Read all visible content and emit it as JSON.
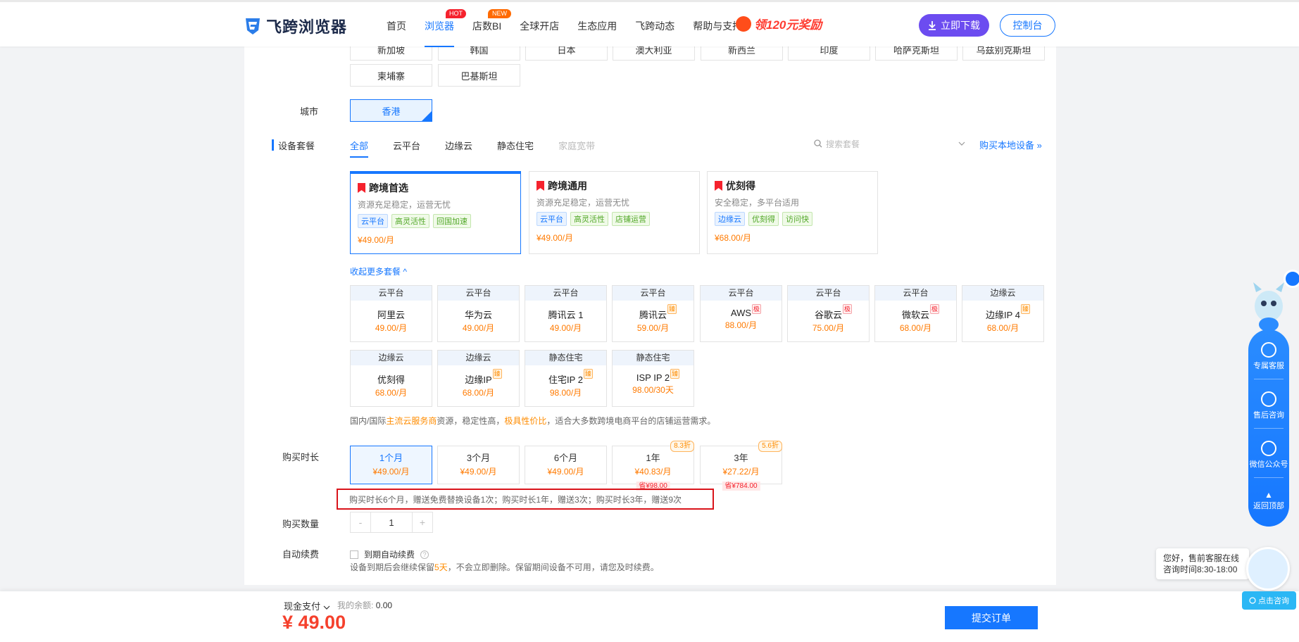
{
  "header": {
    "logo_text": "飞跨浏览器",
    "nav": [
      {
        "label": "首页"
      },
      {
        "label": "浏览器",
        "badge": "HOT"
      },
      {
        "label": "店数BI",
        "badge": "NEW"
      },
      {
        "label": "全球开店"
      },
      {
        "label": "生态应用"
      },
      {
        "label": "飞跨动态"
      },
      {
        "label": "帮助与支持"
      }
    ],
    "promo": "领120元奖励",
    "download_label": "立即下载",
    "console_label": "控制台"
  },
  "region": {
    "countries_row1": [
      "新加坡",
      "韩国",
      "日本",
      "澳大利亚",
      "新西兰",
      "印度",
      "哈萨克斯坦",
      "乌兹别克斯坦"
    ],
    "countries_row2": [
      "柬埔寨",
      "巴基斯坦"
    ],
    "city_label": "城市",
    "city_selected": "香港"
  },
  "package": {
    "label": "设备套餐",
    "tabs": [
      "全部",
      "云平台",
      "边缘云",
      "静态住宅",
      "家庭宽带"
    ],
    "search_placeholder": "搜索套餐",
    "buy_local": "购买本地设备 »",
    "featured": [
      {
        "title": "跨境首选",
        "desc": "资源充足稳定，运营无忧",
        "tags": [
          "云平台",
          "高灵活性",
          "回国加速"
        ],
        "price": "¥49.00/月"
      },
      {
        "title": "跨境通用",
        "desc": "资源充足稳定，运营无忧",
        "tags": [
          "云平台",
          "高灵活性",
          "店铺运营"
        ],
        "price": "¥49.00/月"
      },
      {
        "title": "优刻得",
        "desc": "安全稳定，多平台适用",
        "tags": [
          "边缘云",
          "优刻得",
          "访问快"
        ],
        "price": "¥68.00/月"
      }
    ],
    "collapse_label": "收起更多套餐 ^",
    "cards": [
      {
        "type": "云平台",
        "name": "阿里云",
        "price": "49.00/月",
        "badge": ""
      },
      {
        "type": "云平台",
        "name": "华为云",
        "price": "49.00/月",
        "badge": ""
      },
      {
        "type": "云平台",
        "name": "腾讯云 1",
        "price": "49.00/月",
        "badge": ""
      },
      {
        "type": "云平台",
        "name": "腾讯云",
        "price": "59.00/月",
        "badge": "臻"
      },
      {
        "type": "云平台",
        "name": "AWS",
        "price": "88.00/月",
        "badge": "极"
      },
      {
        "type": "云平台",
        "name": "谷歌云",
        "price": "75.00/月",
        "badge": "极"
      },
      {
        "type": "云平台",
        "name": "微软云",
        "price": "68.00/月",
        "badge": "极"
      },
      {
        "type": "边缘云",
        "name": "边缘IP 4",
        "price": "68.00/月",
        "badge": "臻"
      },
      {
        "type": "边缘云",
        "name": "优刻得",
        "price": "68.00/月",
        "badge": ""
      },
      {
        "type": "边缘云",
        "name": "边缘IP",
        "price": "68.00/月",
        "badge": "臻"
      },
      {
        "type": "静态住宅",
        "name": "住宅IP 2",
        "price": "98.00/月",
        "badge": "臻"
      },
      {
        "type": "静态住宅",
        "name": "ISP IP 2",
        "price": "98.00/30天",
        "badge": "臻"
      }
    ],
    "desc_parts": [
      "国内/国际",
      "主流云服务商",
      "资源，稳定性高，",
      "极具性价比",
      "，适合大多数跨境电商平台的店铺运营需求。"
    ]
  },
  "duration": {
    "label": "购买时长",
    "options": [
      {
        "label": "1个月",
        "price": "¥49.00/月",
        "discount": "",
        "save": ""
      },
      {
        "label": "3个月",
        "price": "¥49.00/月",
        "discount": "",
        "save": ""
      },
      {
        "label": "6个月",
        "price": "¥49.00/月",
        "discount": "",
        "save": ""
      },
      {
        "label": "1年",
        "price": "¥40.83/月",
        "discount": "8.3折",
        "save": "省¥98.00"
      },
      {
        "label": "3年",
        "price": "¥27.22/月",
        "discount": "5.6折",
        "save": "省¥784.00"
      }
    ],
    "gift_note": "购买时长6个月，赠送免费替换设备1次；购买时长1年，赠送3次；购买时长3年，赠送9次"
  },
  "quantity": {
    "label": "购买数量",
    "minus": "-",
    "value": "1",
    "plus": "+"
  },
  "renew": {
    "label": "自动续费",
    "checkbox_label": "到期自动续费",
    "note_parts": [
      "设备到期后会继续保留",
      "5天",
      "，不会立即删除。保留期间设备不可用，请您及时续费。"
    ]
  },
  "footer": {
    "pay_method": "现金支付",
    "balance_label": "我的余额:",
    "balance_value": "0.00",
    "total": "¥ 49.00",
    "submit": "提交订单"
  },
  "float_bar": {
    "items": [
      "专属客服",
      "售后咨询",
      "微信公众号",
      "返回顶部"
    ],
    "chat_line1": "您好，售前客服在线",
    "chat_line2": "咨询时间8:30-18:00",
    "consult": "点击咨询"
  }
}
